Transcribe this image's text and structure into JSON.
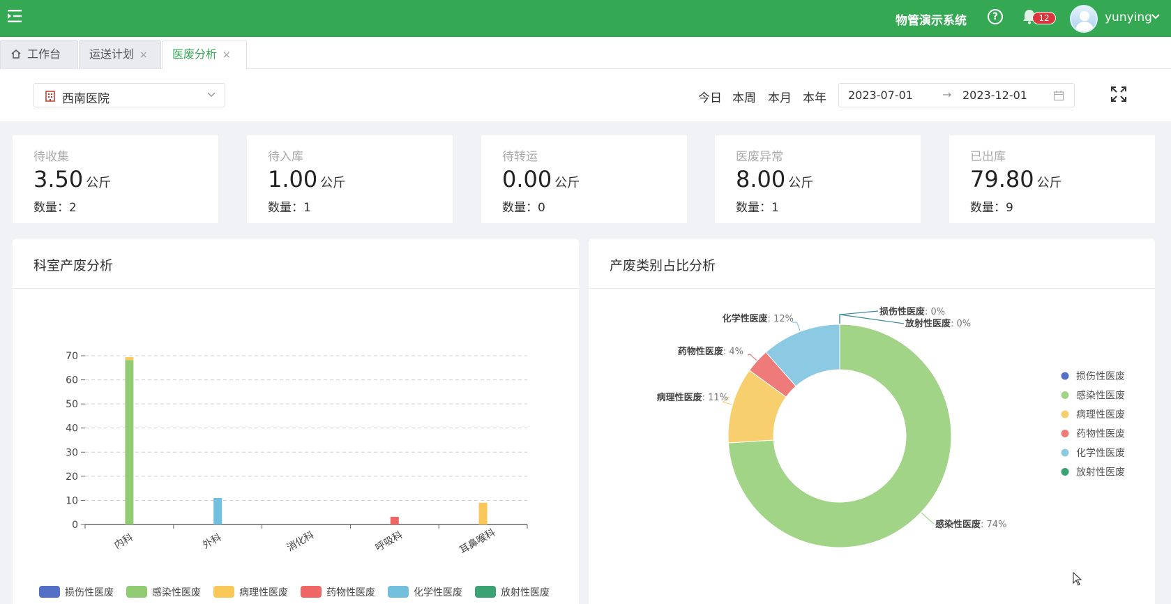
{
  "header": {
    "system_title": "物管演示系统",
    "help_label": "?",
    "notification_count": "12",
    "username": "yunying",
    "brand_color": "#34a853"
  },
  "tabs": [
    {
      "label": "工作台",
      "icon": "home-icon",
      "closable": false,
      "active": false
    },
    {
      "label": "运送计划",
      "close": "×",
      "closable": true,
      "active": false
    },
    {
      "label": "医废分析",
      "close": "×",
      "closable": true,
      "active": true
    }
  ],
  "filters": {
    "hospital": "西南医院",
    "quick_ranges": [
      "今日",
      "本周",
      "本月",
      "本年"
    ],
    "start_date": "2023-07-01",
    "end_date": "2023-12-01",
    "range_separator": "→"
  },
  "stats": [
    {
      "label": "待收集",
      "value": "3.50",
      "unit": "公斤",
      "count": "数量：2"
    },
    {
      "label": "待入库",
      "value": "1.00",
      "unit": "公斤",
      "count": "数量：1"
    },
    {
      "label": "待转运",
      "value": "0.00",
      "unit": "公斤",
      "count": "数量：0"
    },
    {
      "label": "医废异常",
      "value": "8.00",
      "unit": "公斤",
      "count": "数量：1"
    },
    {
      "label": "已出库",
      "value": "79.80",
      "unit": "公斤",
      "count": "数量：9"
    }
  ],
  "panels": {
    "dept_title": "科室产废分析",
    "category_title": "产废类别占比分析"
  },
  "chart_data": [
    {
      "type": "bar",
      "stacked": true,
      "title": "科室产废分析",
      "categories": [
        "内科",
        "外科",
        "消化科",
        "呼吸科",
        "耳鼻喉科"
      ],
      "ylim": [
        0,
        70
      ],
      "yticks": [
        0,
        10,
        20,
        30,
        40,
        50,
        60,
        70
      ],
      "grid": true,
      "legend_position": "bottom",
      "series": [
        {
          "name": "损伤性医废",
          "color": "#5470c6",
          "values": [
            0,
            0,
            0,
            0,
            0
          ]
        },
        {
          "name": "感染性医废",
          "color": "#91cc75",
          "values": [
            68.2,
            0,
            0,
            0,
            0
          ]
        },
        {
          "name": "病理性医废",
          "color": "#fac858",
          "values": [
            1.2,
            0,
            0,
            0,
            9
          ]
        },
        {
          "name": "药物性医废",
          "color": "#ee6666",
          "values": [
            0,
            0,
            0,
            3.2,
            0
          ]
        },
        {
          "name": "化学性医废",
          "color": "#73c0de",
          "values": [
            0,
            11,
            0,
            0,
            0
          ]
        },
        {
          "name": "放射性医废",
          "color": "#3ba272",
          "values": [
            0,
            0,
            0,
            0,
            0
          ]
        }
      ]
    },
    {
      "type": "pie",
      "donut": true,
      "title": "产废类别占比分析",
      "legend_position": "right",
      "slices": [
        {
          "name": "损伤性医废",
          "value": 0,
          "label": "损伤性医废: 0%",
          "color": "#5470c6"
        },
        {
          "name": "感染性医废",
          "value": 74,
          "label": "感染性医废: 74%",
          "color": "#a2d488"
        },
        {
          "name": "病理性医废",
          "value": 11,
          "label": "病理性医废: 11%",
          "color": "#f8cf6e"
        },
        {
          "name": "药物性医废",
          "value": 3.5,
          "label": "药物性医废: 4%",
          "color": "#ef7a7a"
        },
        {
          "name": "化学性医废",
          "value": 11.5,
          "label": "化学性医废: 12%",
          "color": "#8ccae4"
        },
        {
          "name": "放射性医废",
          "value": 0,
          "label": "放射性医废: 0%",
          "color": "#3ba272"
        }
      ]
    }
  ]
}
